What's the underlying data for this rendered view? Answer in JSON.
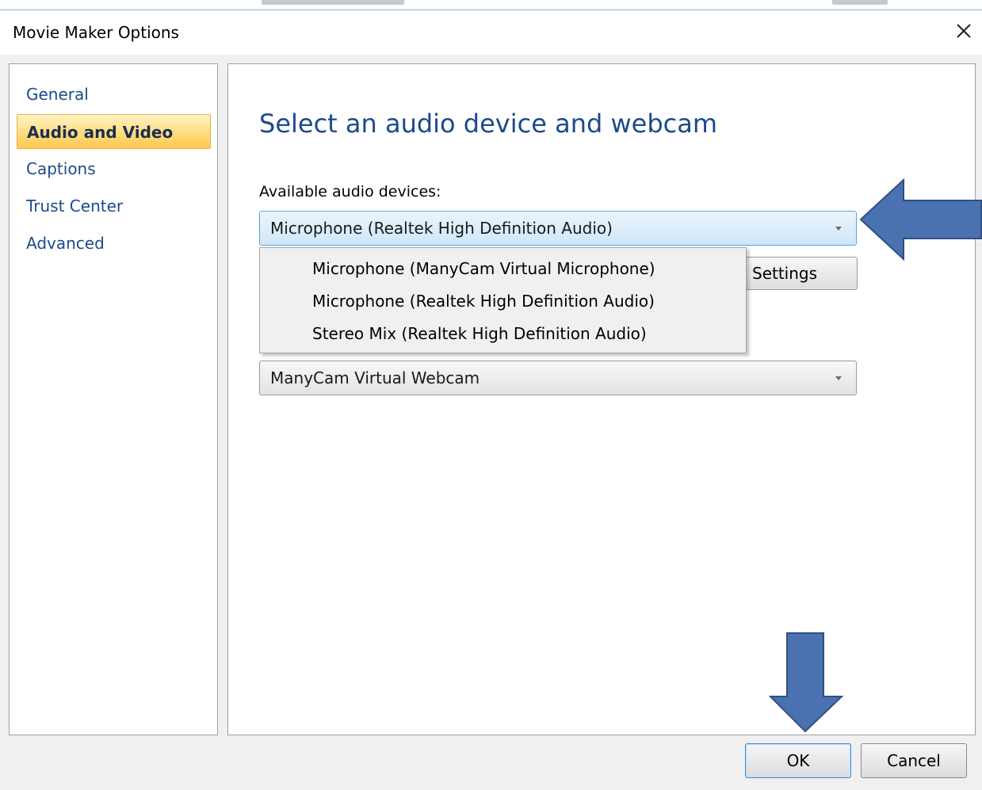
{
  "window": {
    "title": "Movie Maker Options",
    "close_icon": "close-icon"
  },
  "sidebar": {
    "items": [
      {
        "label": "General",
        "active": false
      },
      {
        "label": "Audio and Video",
        "active": true
      },
      {
        "label": "Captions",
        "active": false
      },
      {
        "label": "Trust Center",
        "active": false
      },
      {
        "label": "Advanced",
        "active": false
      }
    ]
  },
  "main": {
    "heading": "Select an audio device and webcam",
    "audio_label": "Available audio devices:",
    "audio_selected": "Microphone (Realtek High Definition Audio)",
    "settings_label": "Settings",
    "audio_options": [
      "Microphone (ManyCam Virtual Microphone)",
      "Microphone (Realtek High Definition Audio)",
      "Stereo Mix (Realtek High Definition Audio)"
    ],
    "webcam_selected": "ManyCam Virtual Webcam"
  },
  "footer": {
    "ok_label": "OK",
    "cancel_label": "Cancel"
  },
  "annotations": {
    "arrow_color": "#4a72b0",
    "arrow_border": "#2f4f82"
  }
}
